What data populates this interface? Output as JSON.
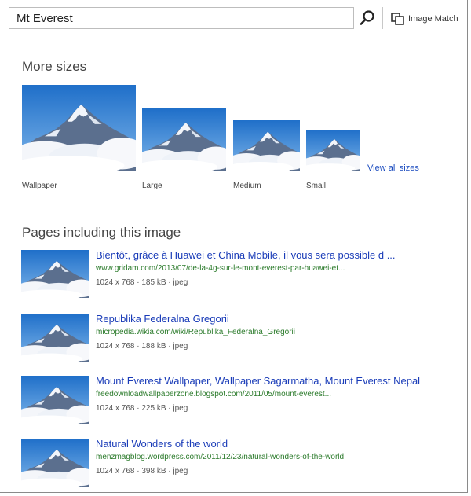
{
  "search": {
    "value": "Mt Everest"
  },
  "header": {
    "image_match_label": "Image Match"
  },
  "more_sizes": {
    "heading": "More sizes",
    "sizes": [
      "Wallpaper",
      "Large",
      "Medium",
      "Small"
    ],
    "view_all": "View all sizes"
  },
  "pages": {
    "heading": "Pages including this image",
    "results": [
      {
        "title": "Bientôt, grâce à Huawei et China Mobile, il vous sera possible d ...",
        "url": "www.gridam.com/2013/07/de-la-4g-sur-le-mont-everest-par-huawei-et...",
        "meta": "1024 x 768 · 185 kB · jpeg"
      },
      {
        "title": "Republika Federalna Gregorii",
        "url": "micropedia.wikia.com/wiki/Republika_Federalna_Gregorii",
        "meta": "1024 x 768 · 188 kB · jpeg"
      },
      {
        "title": "Mount Everest Wallpaper, Wallpaper Sagarmatha, Mount Everest Nepal",
        "url": "freedownloadwallpaperzone.blogspot.com/2011/05/mount-everest...",
        "meta": "1024 x 768 · 225 kB · jpeg"
      },
      {
        "title": "Natural Wonders of the world",
        "url": "menzmagblog.wordpress.com/2011/12/23/natural-wonders-of-the-world",
        "meta": "1024 x 768 · 398 kB · jpeg"
      }
    ]
  },
  "colors": {
    "link": "#1a3cb8",
    "url": "#2a7a2a",
    "sky": "#3a8fd8"
  }
}
